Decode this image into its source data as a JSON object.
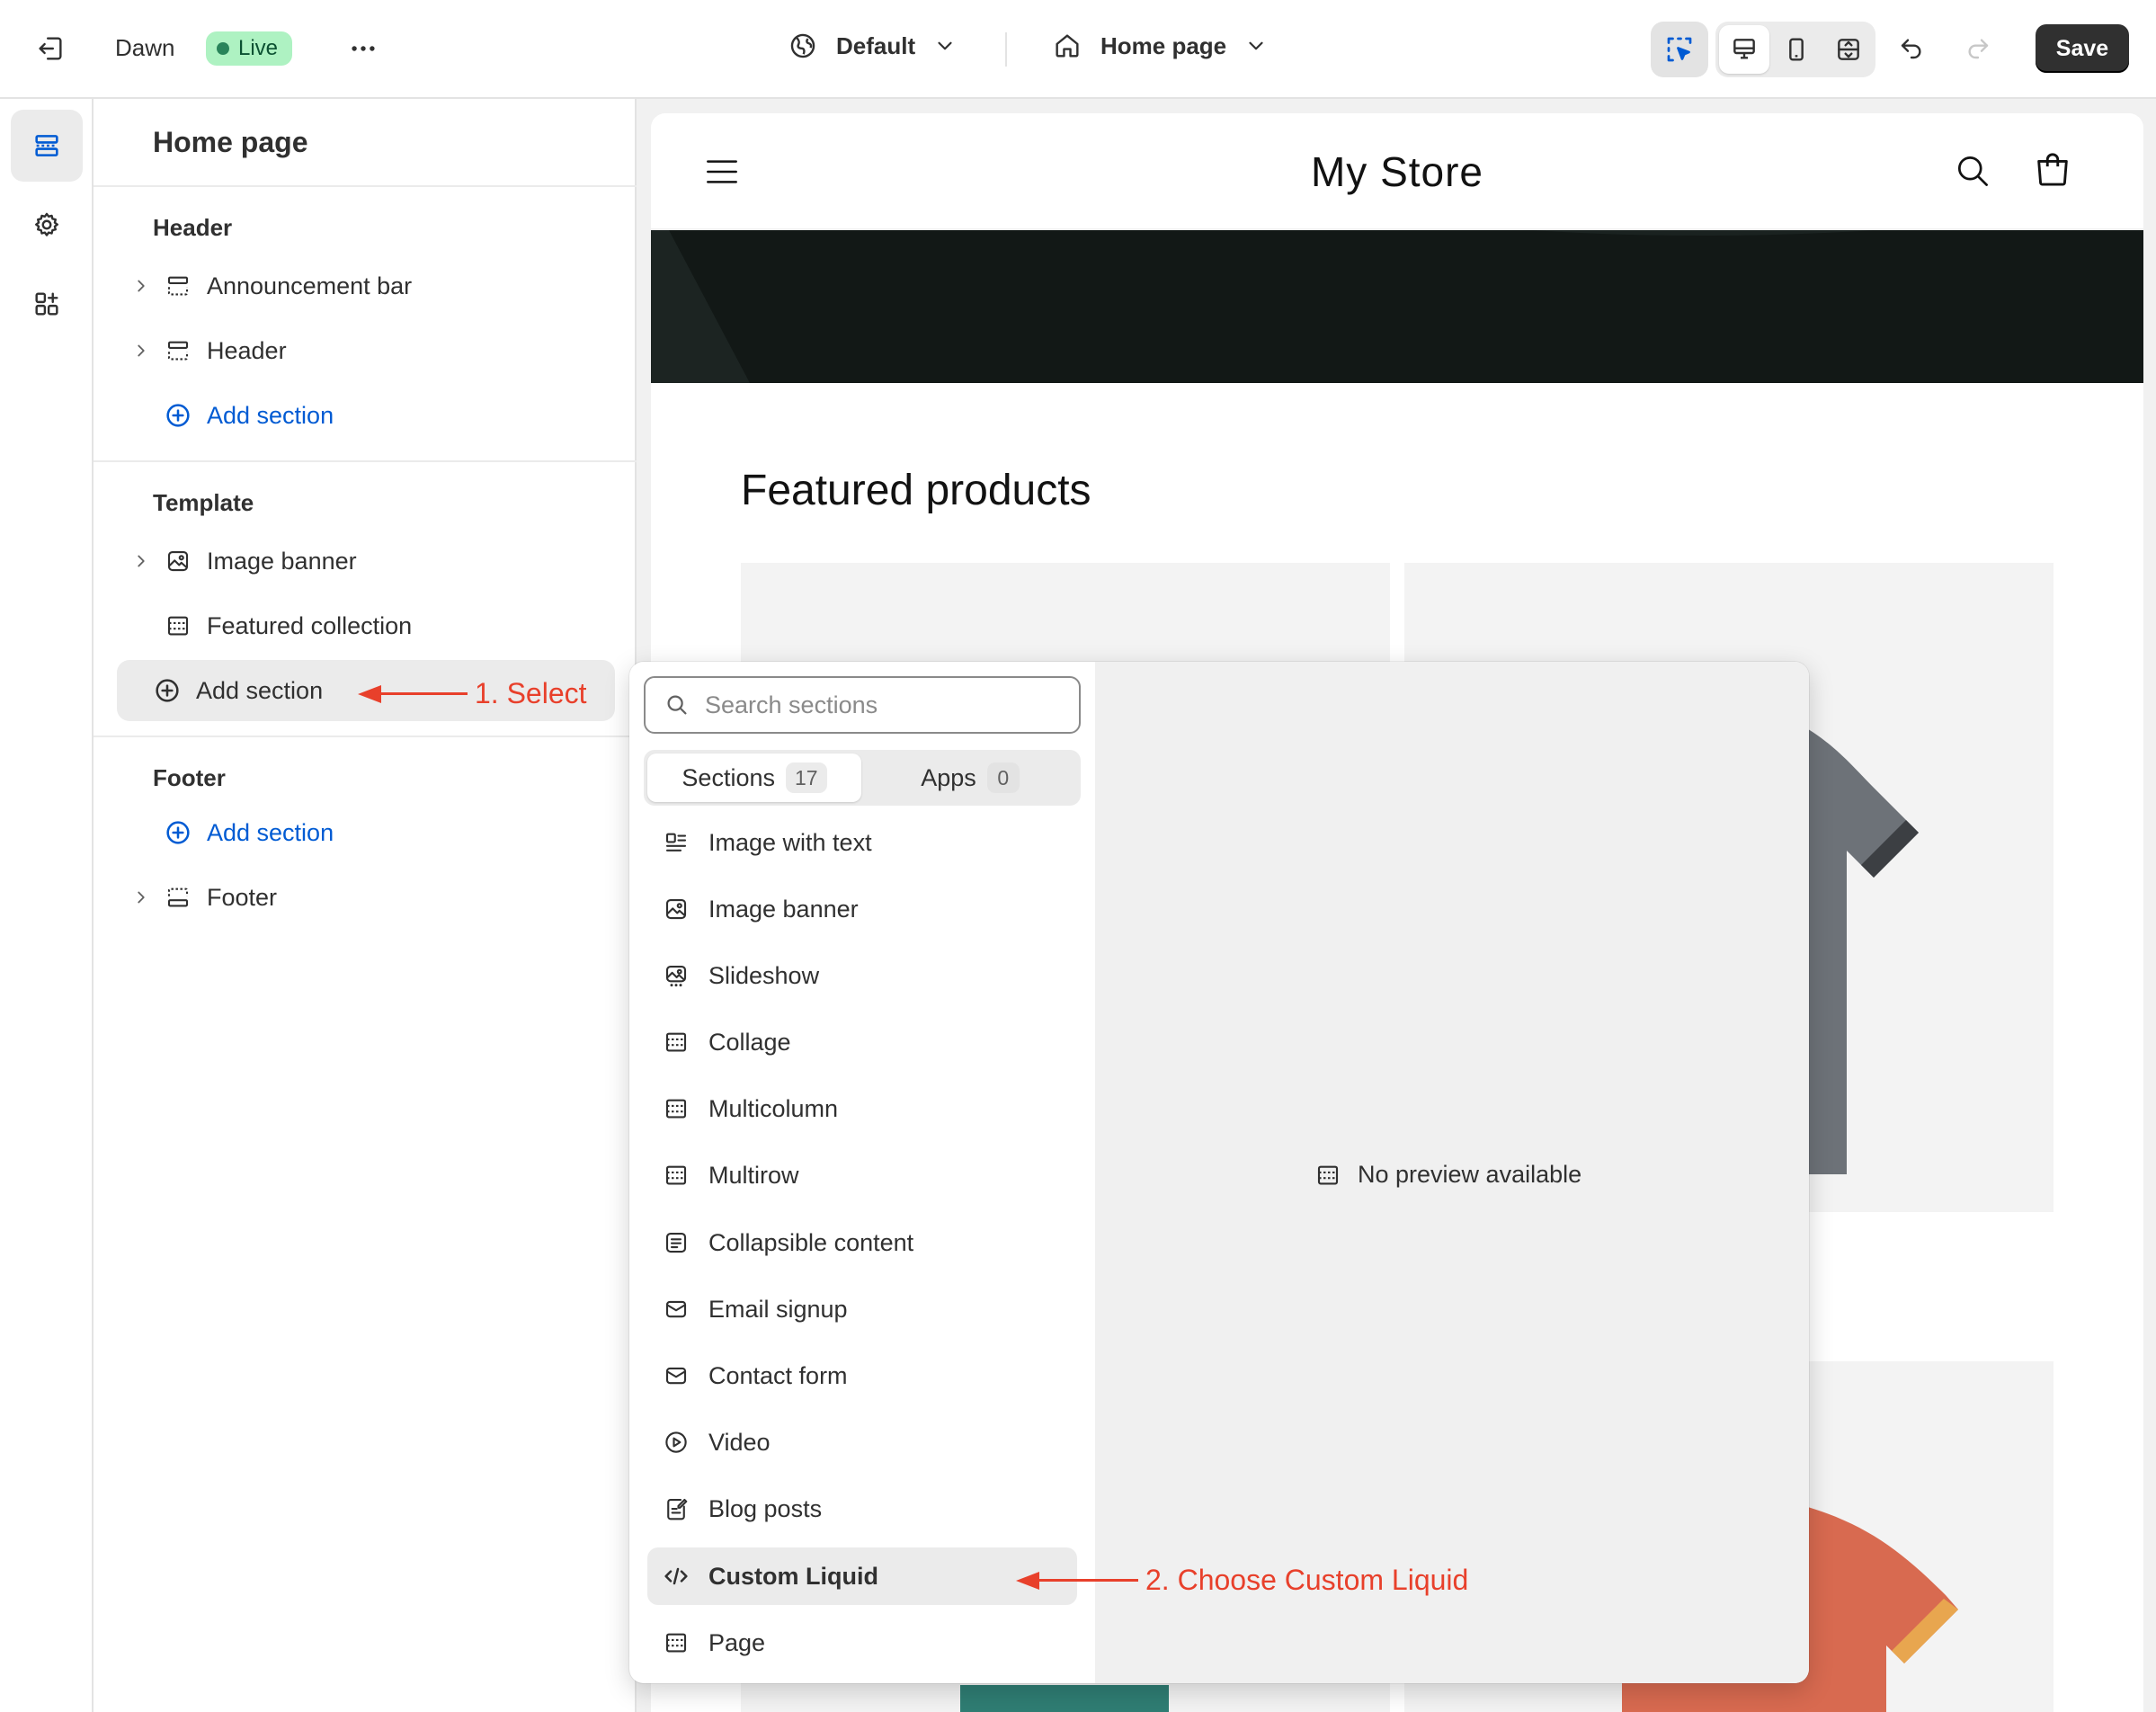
{
  "topbar": {
    "theme_name": "Dawn",
    "status": "Live",
    "more": "•••",
    "language": "Default",
    "page_select": "Home page",
    "save_label": "Save"
  },
  "panel": {
    "title": "Home page",
    "groups": {
      "header": "Header",
      "template": "Template",
      "footer": "Footer"
    },
    "header_items": [
      "Announcement bar",
      "Header"
    ],
    "template_items": [
      "Image banner",
      "Featured collection"
    ],
    "footer_items": [
      "Footer"
    ],
    "add_section": "Add section"
  },
  "preview": {
    "store_name": "My Store",
    "featured_title": "Featured products"
  },
  "popover": {
    "search_placeholder": "Search sections",
    "tabs": [
      {
        "label": "Sections",
        "count": "17"
      },
      {
        "label": "Apps",
        "count": "0"
      }
    ],
    "sections": [
      {
        "label": "Image with text",
        "icon": "image-with-text-icon"
      },
      {
        "label": "Image banner",
        "icon": "image-icon"
      },
      {
        "label": "Slideshow",
        "icon": "slideshow-icon"
      },
      {
        "label": "Collage",
        "icon": "section-icon"
      },
      {
        "label": "Multicolumn",
        "icon": "section-icon"
      },
      {
        "label": "Multirow",
        "icon": "section-icon"
      },
      {
        "label": "Collapsible content",
        "icon": "collapsible-icon"
      },
      {
        "label": "Email signup",
        "icon": "email-icon"
      },
      {
        "label": "Contact form",
        "icon": "email-icon"
      },
      {
        "label": "Video",
        "icon": "play-icon"
      },
      {
        "label": "Blog posts",
        "icon": "blog-icon"
      },
      {
        "label": "Custom Liquid",
        "icon": "code-icon"
      },
      {
        "label": "Page",
        "icon": "section-icon"
      }
    ],
    "selected_index": 11,
    "no_preview": "No preview available"
  },
  "annotations": {
    "step1": "1. Select",
    "step2": "2. Choose Custom Liquid"
  },
  "colors": {
    "accent": "#005bd3",
    "annotation": "#e8402b",
    "live_badge": "#aef2c2"
  }
}
